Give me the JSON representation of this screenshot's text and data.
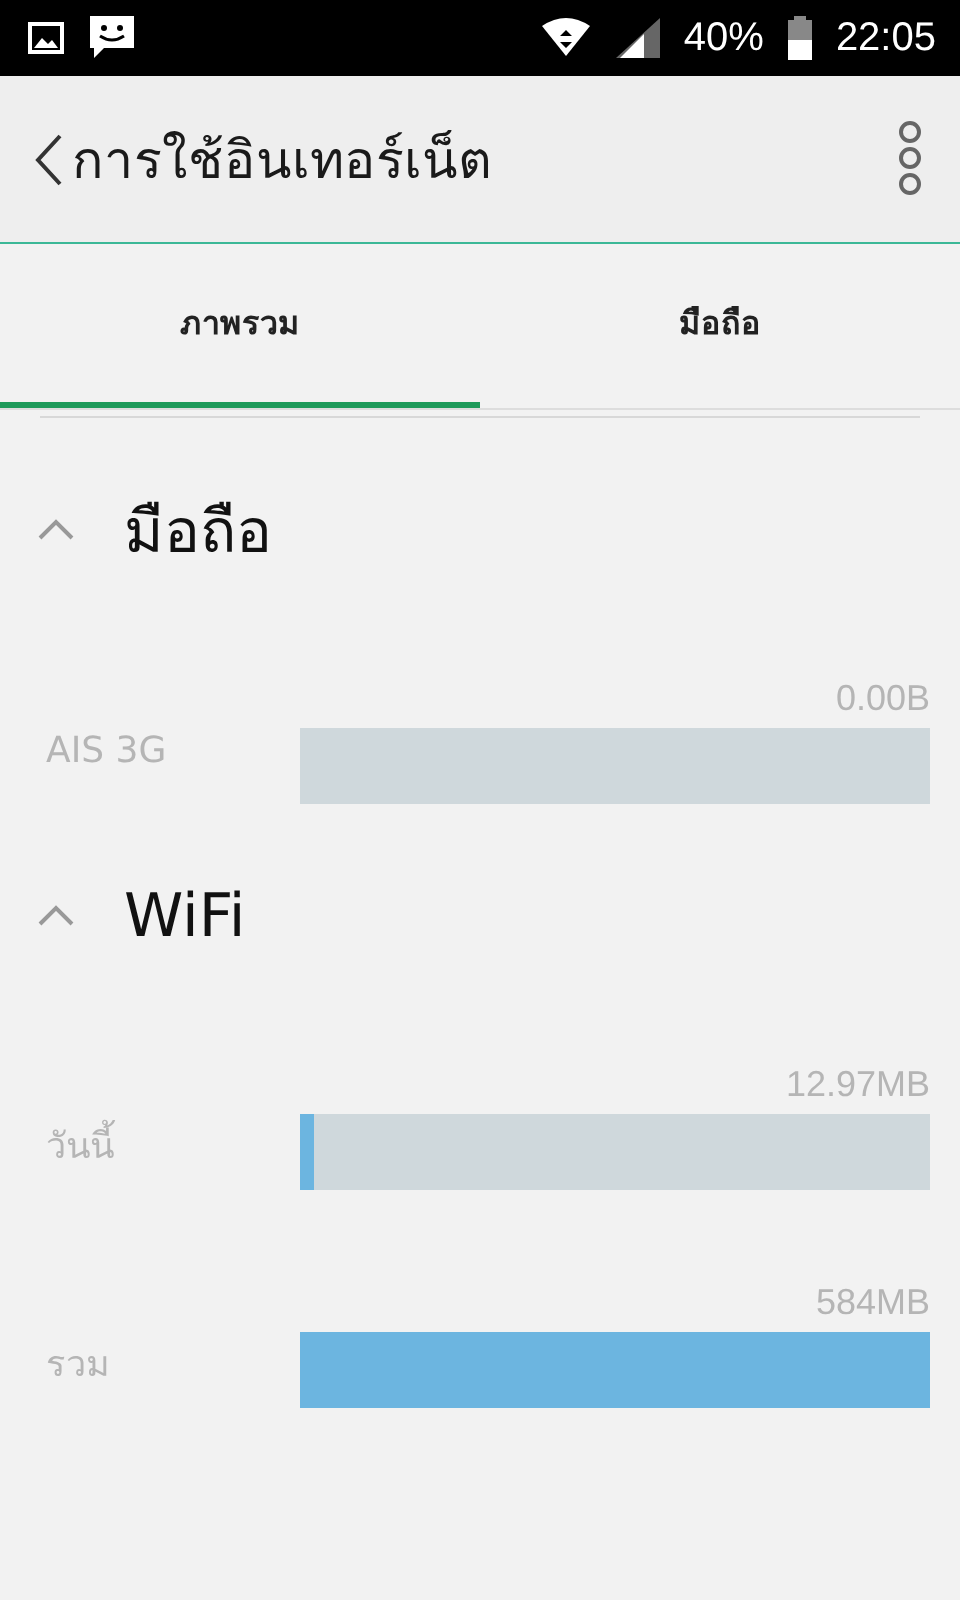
{
  "status_bar": {
    "battery": "40%",
    "time": "22:05"
  },
  "app_bar": {
    "title": "การใช้อินเทอร์เน็ต"
  },
  "tabs": [
    {
      "label": "ภาพรวม",
      "selected": true
    },
    {
      "label": "มือถือ",
      "selected": false
    }
  ],
  "sections": [
    {
      "title": "มือถือ",
      "expanded": true,
      "rows": [
        {
          "label": "AIS 3G",
          "reading": "0.00B"
        }
      ]
    },
    {
      "title": "WiFi",
      "expanded": true,
      "rows": [
        {
          "label": "วันนี้",
          "reading": "12.97MB",
          "level": 0.02
        },
        {
          "label": "รวม",
          "reading": "584MB",
          "level": 1
        }
      ]
    }
  ]
}
